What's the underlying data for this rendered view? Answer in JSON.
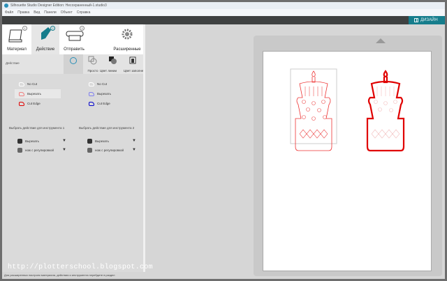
{
  "window": {
    "title": "Silhouette Studio Designer Edition: Несохраненный-1.studio3"
  },
  "menu": [
    "Файл",
    "Правка",
    "Вид",
    "Панели",
    "Объект",
    "Справка"
  ],
  "toolbar": {
    "design_label": "ДИЗАЙН"
  },
  "tabs": [
    {
      "label": "Материал",
      "num": "1"
    },
    {
      "label": "Действие",
      "num": "2"
    },
    {
      "label": "Отправить",
      "num": "3"
    },
    {
      "label": "Расширенные"
    }
  ],
  "action": {
    "label": "Действие",
    "modes": [
      "Просто",
      "Цвет линии",
      "Цвет заполнения",
      "Слой"
    ]
  },
  "tool1_options": [
    "No Cut",
    "Вырезать",
    "Cut Edge"
  ],
  "tool2_options": [
    "No Cut",
    "Вырезать",
    "Cut Edge"
  ],
  "select_tool1": "Выбрать действие для инструмента 1",
  "select_tool2": "Выбрать действие для инструмента 2",
  "tool1": {
    "action": "Вырезать",
    "tool": "нож с регулировкой"
  },
  "tool2": {
    "action": "Вырезать",
    "tool": "нож с регулировкой"
  },
  "status": "Для расширенных настроек материала, действия и инструмента перейдите в раздел",
  "watermark": "http://plotterschool.blogspot.com",
  "colors": {
    "accent": "#167d8c",
    "cut_red": "#e00000",
    "cut_blue": "#0000cc"
  }
}
